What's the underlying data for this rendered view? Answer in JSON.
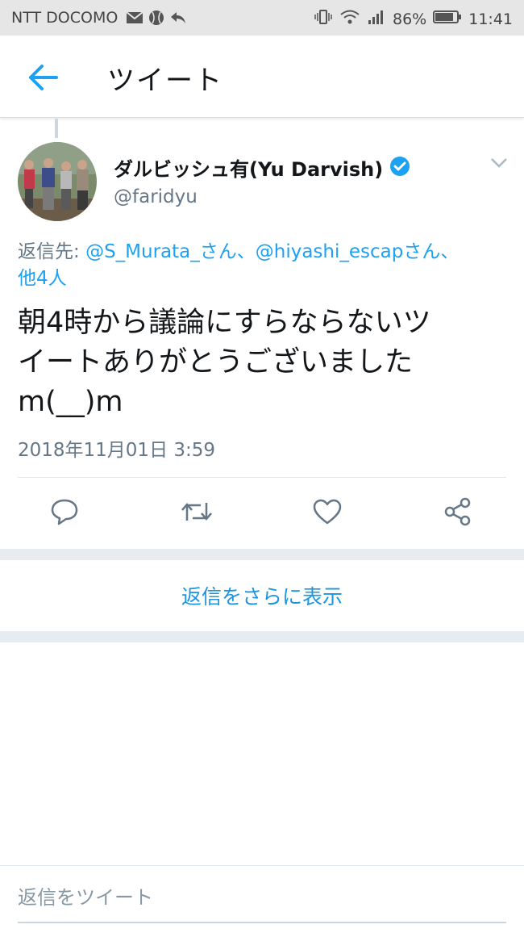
{
  "statusbar": {
    "carrier": "NTT DOCOMO",
    "battery": "86%",
    "time": "11:41"
  },
  "header": {
    "title": "ツイート"
  },
  "tweet": {
    "display_name": "ダルビッシュ有(Yu Darvish)",
    "handle": "@faridyu",
    "reply_prefix": "返信先: ",
    "mention_1": "@S_Murata_さん、",
    "mention_2": "@hiyashi_escapさん、",
    "mention_more": "他4人",
    "text_line1": "朝4時から議論にすらならないツ",
    "text_line2": "イートありがとうございました",
    "text_line3": "m(__)m",
    "timestamp": "2018年11月01日 3:59",
    "verified_color": "#1da1f2"
  },
  "actions": [
    "reply-icon",
    "retweet-icon",
    "like-icon",
    "share-icon"
  ],
  "more_replies_label": "返信をさらに表示",
  "compose": {
    "placeholder": "返信をツイート"
  }
}
